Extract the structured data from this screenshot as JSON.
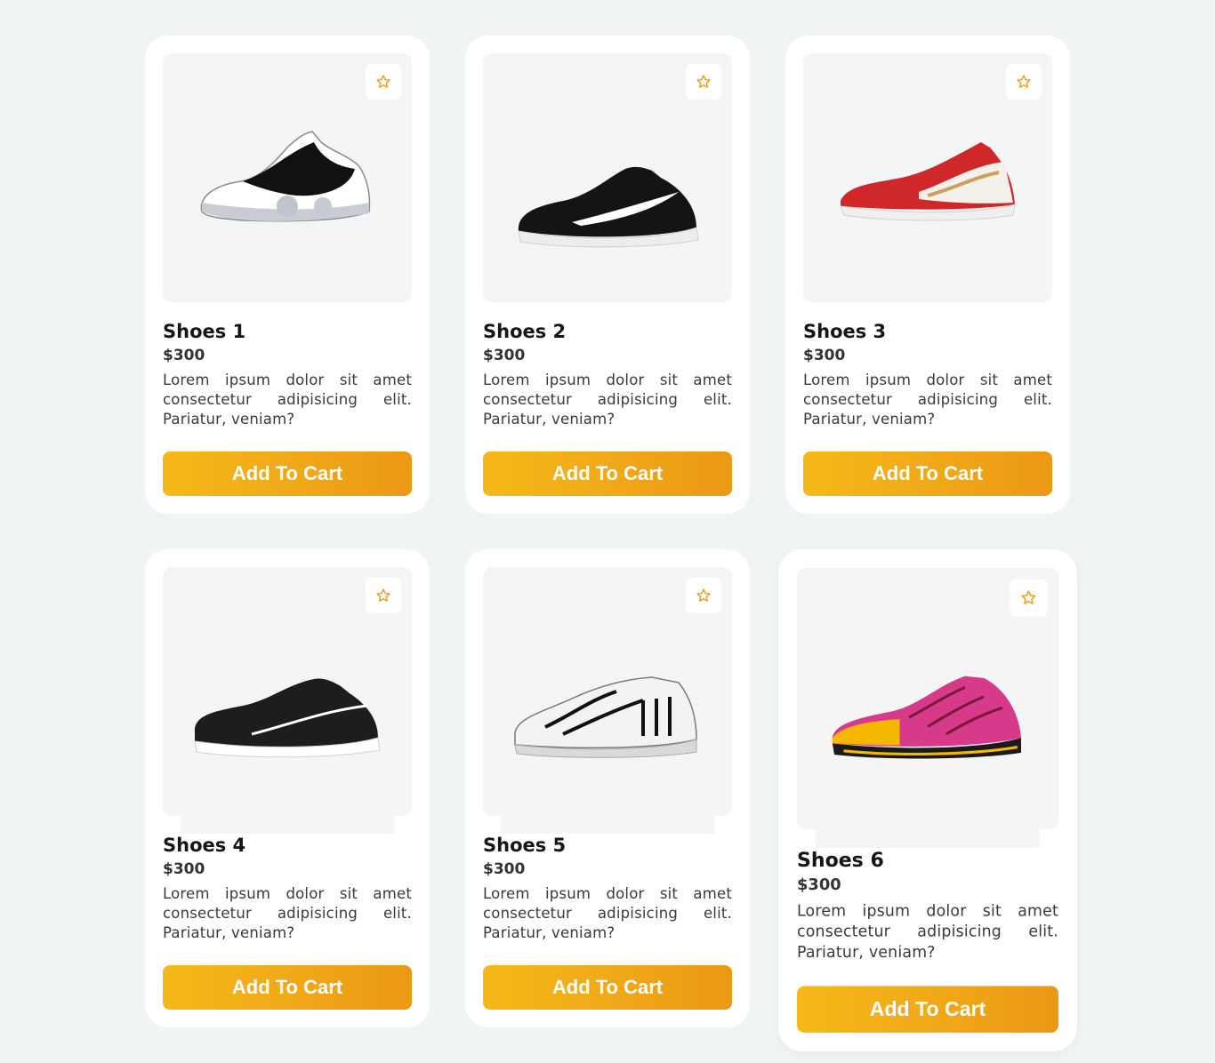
{
  "colors": {
    "background": "#f1f4f5",
    "card": "#ffffff",
    "button_start": "#f6b919",
    "button_end": "#eb9916",
    "star": "#f0a020"
  },
  "products": [
    {
      "title": "Shoes 1",
      "price": "$300",
      "description": "Lorem ipsum dolor sit amet consectetur adipisicing elit. Pariatur, veniam?",
      "button": "Add To Cart",
      "icon": "star-icon",
      "shoe_colors": [
        "#ffffff",
        "#111111",
        "#c9ccd3"
      ]
    },
    {
      "title": "Shoes 2",
      "price": "$300",
      "description": "Lorem ipsum dolor sit amet consectetur adipisicing elit. Pariatur, veniam?",
      "button": "Add To Cart",
      "icon": "star-icon",
      "shoe_colors": [
        "#141414",
        "#ffffff",
        "#ededed"
      ]
    },
    {
      "title": "Shoes 3",
      "price": "$300",
      "description": "Lorem ipsum dolor sit amet consectetur adipisicing elit. Pariatur, veniam?",
      "button": "Add To Cart",
      "icon": "star-icon",
      "shoe_colors": [
        "#d0282a",
        "#f4f0ea",
        "#c9a25c"
      ]
    },
    {
      "title": "Shoes 4",
      "price": "$300",
      "description": "Lorem ipsum dolor sit amet consectetur adipisicing elit. Pariatur, veniam?",
      "button": "Add To Cart",
      "icon": "star-icon",
      "shoe_colors": [
        "#1d1d1f",
        "#ffffff",
        "#e5e5e5"
      ]
    },
    {
      "title": "Shoes 5",
      "price": "$300",
      "description": "Lorem ipsum dolor sit amet consectetur adipisicing elit. Pariatur, veniam?",
      "button": "Add To Cart",
      "icon": "star-icon",
      "shoe_colors": [
        "#f3f3f3",
        "#111111",
        "#d9d9d9"
      ]
    },
    {
      "title": "Shoes 6",
      "price": "$300",
      "description": "Lorem ipsum dolor sit amet consectetur adipisicing elit. Pariatur, veniam?",
      "button": "Add To Cart",
      "icon": "star-icon",
      "shoe_colors": [
        "#d83a8a",
        "#f5b700",
        "#1a1a1a"
      ]
    }
  ]
}
